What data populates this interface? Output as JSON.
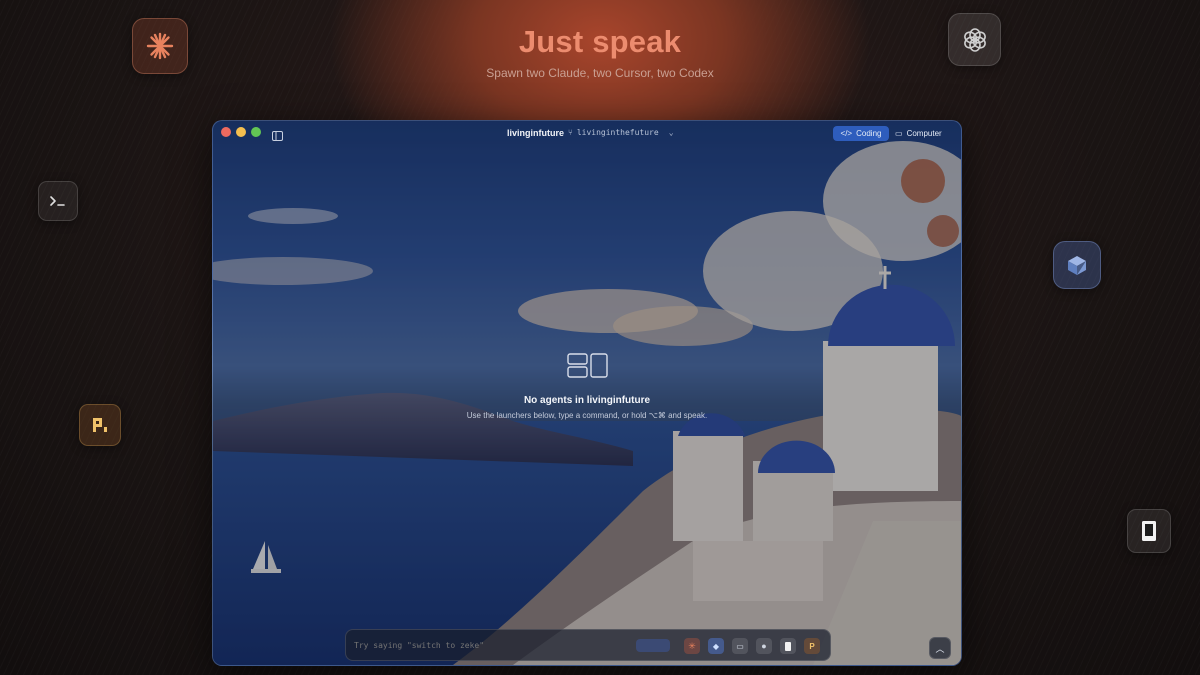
{
  "hero": {
    "title": "Just speak",
    "subtitle": "Spawn two Claude, two Cursor, two Codex"
  },
  "floating_icons": {
    "claude": "claude-sparkle-icon",
    "openai": "openai-knot-icon",
    "terminal": "terminal-icon",
    "cursor": "cursor-cube-icon",
    "pixel": "pixel-p-icon",
    "device": "device-icon"
  },
  "window": {
    "workspace_title": "livinginfuture",
    "branch": "livinginthefuture",
    "modes": {
      "coding": "Coding",
      "computer": "Computer"
    },
    "empty_state": {
      "title": "No agents in livinginfuture",
      "hint": "Use the launchers below, type a command, or hold ⌥⌘ and speak."
    },
    "command": {
      "placeholder": "Try saying \"switch to zeke\""
    }
  },
  "colors": {
    "accent_blue": "#2e5dbd",
    "hero_text": "#ec8c6f",
    "traffic_red": "#ee6a5f",
    "traffic_yellow": "#f5bf4f",
    "traffic_green": "#62c554"
  }
}
